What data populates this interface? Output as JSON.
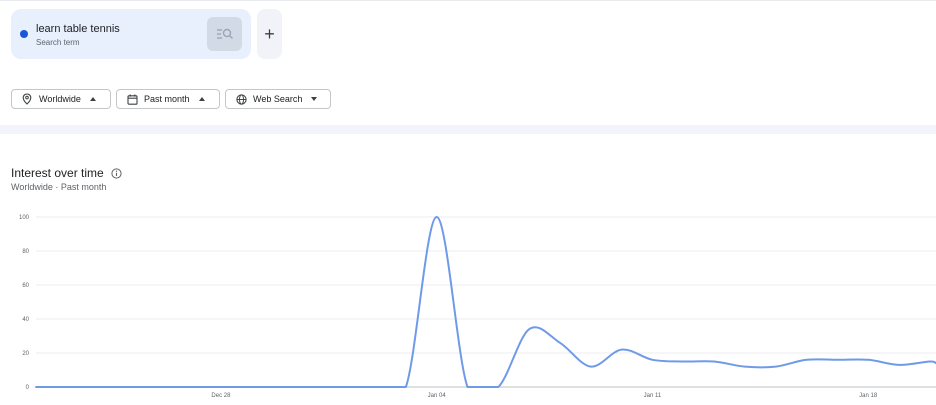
{
  "search_term": {
    "label": "learn table tennis",
    "type_label": "Search term",
    "color": "#1a56db"
  },
  "add_term": {
    "label": "+"
  },
  "filters": {
    "region": {
      "label": "Worldwide",
      "icon": "location-pin-icon"
    },
    "time": {
      "label": "Past month",
      "icon": "calendar-icon"
    },
    "property": {
      "label": "Web Search",
      "icon": "globe-icon"
    }
  },
  "section": {
    "title": "Interest over time",
    "subtitle": "Worldwide · Past month",
    "info_icon": "info-icon"
  },
  "chart_data": {
    "type": "line",
    "title": "",
    "xlabel": "",
    "ylabel": "",
    "ylim": [
      0,
      100
    ],
    "y_ticks": [
      0,
      20,
      40,
      60,
      80,
      100
    ],
    "x_tick_labels": [
      {
        "label": "Dec 28",
        "day": 6
      },
      {
        "label": "Jan 04",
        "day": 13
      },
      {
        "label": "Jan 11",
        "day": 20
      },
      {
        "label": "Jan 18",
        "day": 27
      }
    ],
    "x_range": [
      0,
      29.2
    ],
    "grid": true,
    "series": [
      {
        "color": "#6f9ae8",
        "x": [
          0,
          1,
          2,
          3,
          4,
          5,
          6,
          7,
          8,
          9,
          10,
          11,
          12,
          13,
          14,
          15,
          16,
          17,
          18,
          19,
          20,
          21,
          22,
          23,
          24,
          25,
          26,
          27,
          28,
          29,
          29.2
        ],
        "values": [
          0,
          0,
          0,
          0,
          0,
          0,
          0,
          0,
          0,
          0,
          0,
          0,
          0,
          100,
          0,
          0,
          34,
          26,
          12,
          22,
          16,
          15,
          15,
          12,
          12,
          16,
          16,
          16,
          13,
          15,
          14
        ]
      }
    ]
  }
}
